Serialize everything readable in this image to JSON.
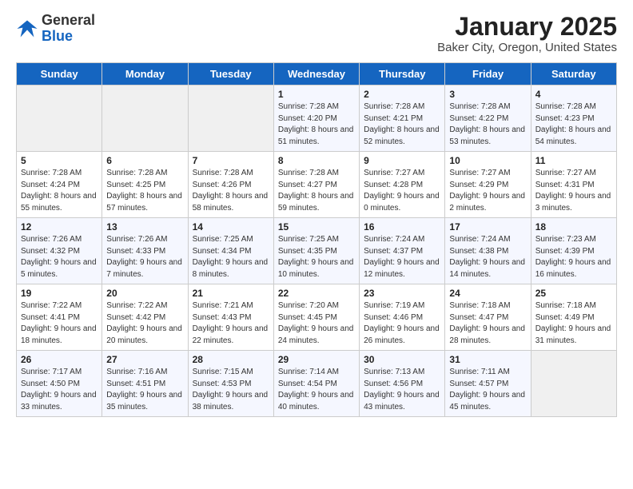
{
  "header": {
    "logo_line1": "General",
    "logo_line2": "Blue",
    "title": "January 2025",
    "subtitle": "Baker City, Oregon, United States"
  },
  "days_of_week": [
    "Sunday",
    "Monday",
    "Tuesday",
    "Wednesday",
    "Thursday",
    "Friday",
    "Saturday"
  ],
  "weeks": [
    [
      {
        "num": "",
        "info": ""
      },
      {
        "num": "",
        "info": ""
      },
      {
        "num": "",
        "info": ""
      },
      {
        "num": "1",
        "info": "Sunrise: 7:28 AM\nSunset: 4:20 PM\nDaylight: 8 hours and 51 minutes."
      },
      {
        "num": "2",
        "info": "Sunrise: 7:28 AM\nSunset: 4:21 PM\nDaylight: 8 hours and 52 minutes."
      },
      {
        "num": "3",
        "info": "Sunrise: 7:28 AM\nSunset: 4:22 PM\nDaylight: 8 hours and 53 minutes."
      },
      {
        "num": "4",
        "info": "Sunrise: 7:28 AM\nSunset: 4:23 PM\nDaylight: 8 hours and 54 minutes."
      }
    ],
    [
      {
        "num": "5",
        "info": "Sunrise: 7:28 AM\nSunset: 4:24 PM\nDaylight: 8 hours and 55 minutes."
      },
      {
        "num": "6",
        "info": "Sunrise: 7:28 AM\nSunset: 4:25 PM\nDaylight: 8 hours and 57 minutes."
      },
      {
        "num": "7",
        "info": "Sunrise: 7:28 AM\nSunset: 4:26 PM\nDaylight: 8 hours and 58 minutes."
      },
      {
        "num": "8",
        "info": "Sunrise: 7:28 AM\nSunset: 4:27 PM\nDaylight: 8 hours and 59 minutes."
      },
      {
        "num": "9",
        "info": "Sunrise: 7:27 AM\nSunset: 4:28 PM\nDaylight: 9 hours and 0 minutes."
      },
      {
        "num": "10",
        "info": "Sunrise: 7:27 AM\nSunset: 4:29 PM\nDaylight: 9 hours and 2 minutes."
      },
      {
        "num": "11",
        "info": "Sunrise: 7:27 AM\nSunset: 4:31 PM\nDaylight: 9 hours and 3 minutes."
      }
    ],
    [
      {
        "num": "12",
        "info": "Sunrise: 7:26 AM\nSunset: 4:32 PM\nDaylight: 9 hours and 5 minutes."
      },
      {
        "num": "13",
        "info": "Sunrise: 7:26 AM\nSunset: 4:33 PM\nDaylight: 9 hours and 7 minutes."
      },
      {
        "num": "14",
        "info": "Sunrise: 7:25 AM\nSunset: 4:34 PM\nDaylight: 9 hours and 8 minutes."
      },
      {
        "num": "15",
        "info": "Sunrise: 7:25 AM\nSunset: 4:35 PM\nDaylight: 9 hours and 10 minutes."
      },
      {
        "num": "16",
        "info": "Sunrise: 7:24 AM\nSunset: 4:37 PM\nDaylight: 9 hours and 12 minutes."
      },
      {
        "num": "17",
        "info": "Sunrise: 7:24 AM\nSunset: 4:38 PM\nDaylight: 9 hours and 14 minutes."
      },
      {
        "num": "18",
        "info": "Sunrise: 7:23 AM\nSunset: 4:39 PM\nDaylight: 9 hours and 16 minutes."
      }
    ],
    [
      {
        "num": "19",
        "info": "Sunrise: 7:22 AM\nSunset: 4:41 PM\nDaylight: 9 hours and 18 minutes."
      },
      {
        "num": "20",
        "info": "Sunrise: 7:22 AM\nSunset: 4:42 PM\nDaylight: 9 hours and 20 minutes."
      },
      {
        "num": "21",
        "info": "Sunrise: 7:21 AM\nSunset: 4:43 PM\nDaylight: 9 hours and 22 minutes."
      },
      {
        "num": "22",
        "info": "Sunrise: 7:20 AM\nSunset: 4:45 PM\nDaylight: 9 hours and 24 minutes."
      },
      {
        "num": "23",
        "info": "Sunrise: 7:19 AM\nSunset: 4:46 PM\nDaylight: 9 hours and 26 minutes."
      },
      {
        "num": "24",
        "info": "Sunrise: 7:18 AM\nSunset: 4:47 PM\nDaylight: 9 hours and 28 minutes."
      },
      {
        "num": "25",
        "info": "Sunrise: 7:18 AM\nSunset: 4:49 PM\nDaylight: 9 hours and 31 minutes."
      }
    ],
    [
      {
        "num": "26",
        "info": "Sunrise: 7:17 AM\nSunset: 4:50 PM\nDaylight: 9 hours and 33 minutes."
      },
      {
        "num": "27",
        "info": "Sunrise: 7:16 AM\nSunset: 4:51 PM\nDaylight: 9 hours and 35 minutes."
      },
      {
        "num": "28",
        "info": "Sunrise: 7:15 AM\nSunset: 4:53 PM\nDaylight: 9 hours and 38 minutes."
      },
      {
        "num": "29",
        "info": "Sunrise: 7:14 AM\nSunset: 4:54 PM\nDaylight: 9 hours and 40 minutes."
      },
      {
        "num": "30",
        "info": "Sunrise: 7:13 AM\nSunset: 4:56 PM\nDaylight: 9 hours and 43 minutes."
      },
      {
        "num": "31",
        "info": "Sunrise: 7:11 AM\nSunset: 4:57 PM\nDaylight: 9 hours and 45 minutes."
      },
      {
        "num": "",
        "info": ""
      }
    ]
  ]
}
